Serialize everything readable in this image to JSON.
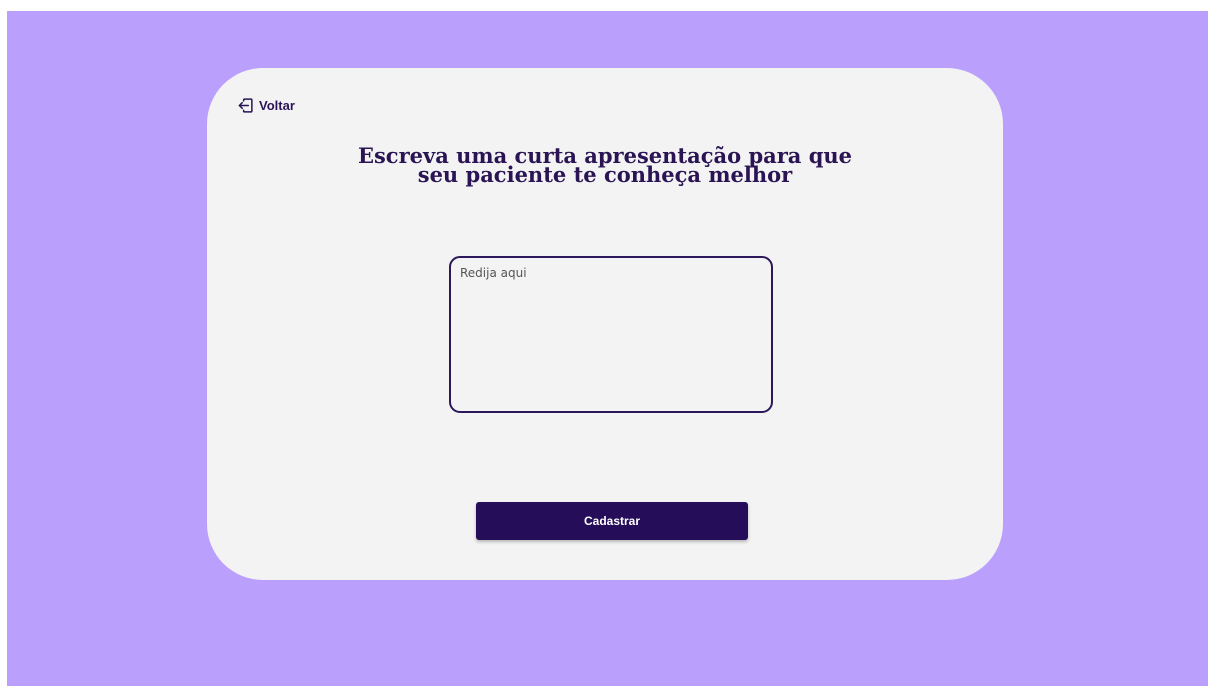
{
  "back": {
    "icon": "log-in-icon",
    "label": "Voltar"
  },
  "heading": {
    "line1": "Escreva uma curta apresentação para que",
    "line2": "seu paciente te conheça melhor"
  },
  "bio_input": {
    "value": "",
    "placeholder": "Redija aqui"
  },
  "submit": {
    "label": "Cadastrar"
  },
  "colors": {
    "background": "#bb9ffd",
    "card": "#f3f3f4",
    "primary": "#250d59",
    "text": "#2a1454"
  }
}
